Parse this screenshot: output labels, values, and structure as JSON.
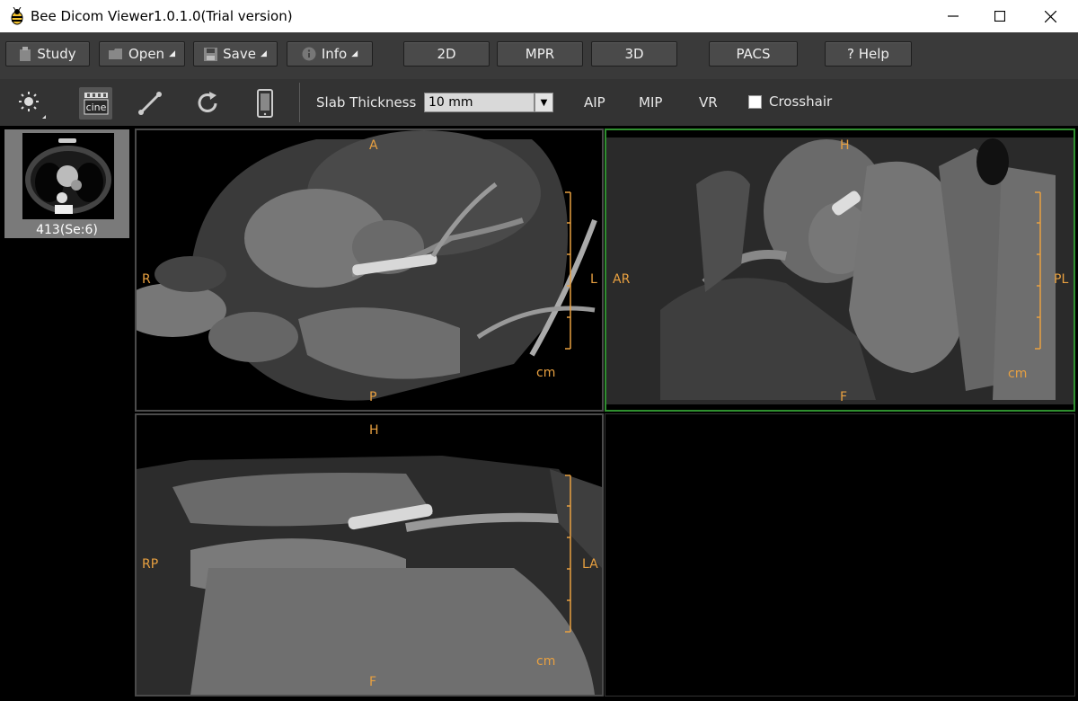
{
  "window": {
    "title": "Bee Dicom Viewer1.0.1.0(Trial version)"
  },
  "toolbar": {
    "study": "Study",
    "open": "Open",
    "save": "Save",
    "info": "Info",
    "mode_2d": "2D",
    "mode_mpr": "MPR",
    "mode_3d": "3D",
    "pacs": "PACS",
    "help": "? Help"
  },
  "tools": {
    "cine_label": "cine",
    "slab_label": "Slab Thickness",
    "slab_value": "10 mm",
    "aip": "AIP",
    "mip": "MIP",
    "vr": "VR",
    "crosshair": "Crosshair"
  },
  "series": {
    "thumbnail_label": "413(Se:6)"
  },
  "viewports": {
    "axial": {
      "top": "A",
      "bottom": "P",
      "left": "R",
      "right": "L",
      "unit": "cm"
    },
    "coronal": {
      "top": "H",
      "bottom": "F",
      "left": "AR",
      "right": "PL",
      "unit": "cm"
    },
    "sagittal": {
      "top": "H",
      "bottom": "F",
      "left": "RP",
      "right": "LA",
      "unit": "cm"
    }
  },
  "colors": {
    "accent_orange": "#e8a040",
    "active_border": "#2f8f2f"
  }
}
